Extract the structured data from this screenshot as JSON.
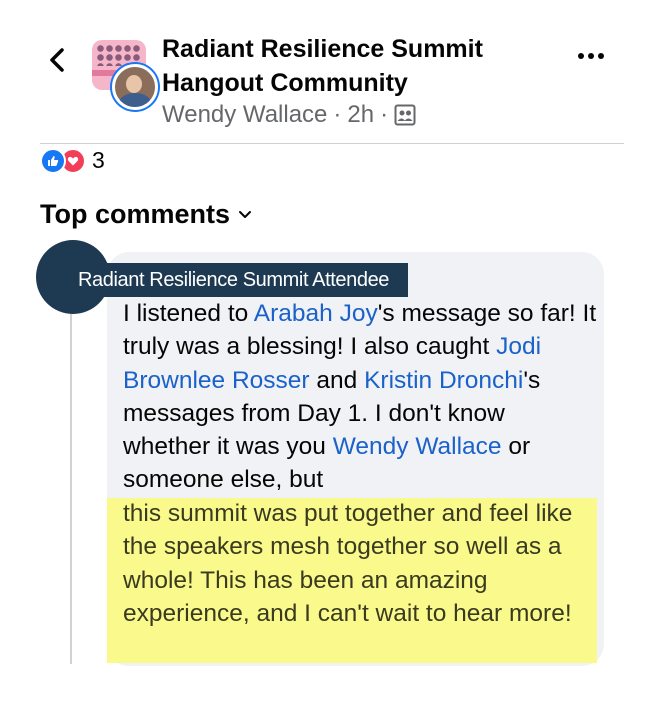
{
  "post_header": {
    "group_name": "Radiant Resilience Summit Hangout Community",
    "author": "Wendy Wallace",
    "separator": "·",
    "time": "2h",
    "audience_icon": "group-audience-icon",
    "back_icon": "chevron-left-icon",
    "more_icon": "more-horizontal-icon"
  },
  "reactions": {
    "icons": [
      "like-icon",
      "love-icon"
    ],
    "count": "3"
  },
  "comments_section": {
    "sort_label": "Top comments",
    "sort_icon": "chevron-down-icon"
  },
  "comment": {
    "author_badge": "Radiant Resilience Summit Attendee",
    "segments": {
      "s1": "I listened to ",
      "m1": "Arabah Joy",
      "s2": "'s message so far! It truly was a blessing! I also caught ",
      "m2": "Jodi Brownlee Rosser",
      "s3": " and ",
      "m3": "Kristin Dronchi",
      "s4": "'s messages from Day 1. I don't know whether it was you ",
      "m4": "Wendy Wallace",
      "s5": " or someone else, but"
    },
    "highlighted_text": "this summit was put together and feel like the speakers mesh together so well as a whole! This has been an amazing experience, and I can't wait to hear more!"
  },
  "colors": {
    "mention": "#1a62c9",
    "highlight": "#fafa8c",
    "badge": "#1e3a52",
    "like": "#1877f2",
    "love": "#f33e58"
  }
}
